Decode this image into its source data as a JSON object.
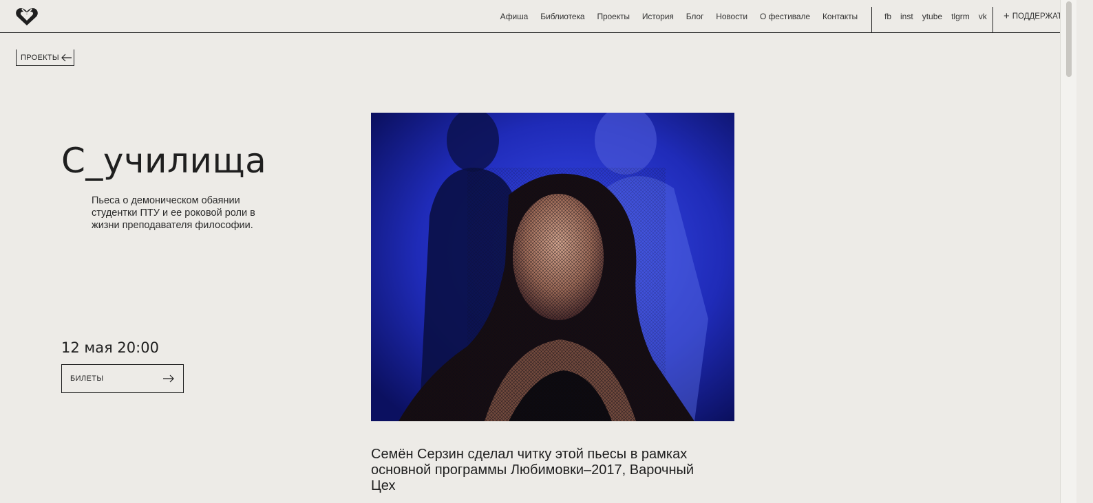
{
  "header": {
    "nav": [
      "Афиша",
      "Библиотека",
      "Проекты",
      "История",
      "Блог",
      "Новости",
      "О фестивале",
      "Контакты"
    ],
    "social": [
      "fb",
      "inst",
      "ytube",
      "tlgrm",
      "vk"
    ],
    "support_label": "ПОДДЕРЖАТЬ"
  },
  "back": {
    "label": "ПРОЕКТЫ"
  },
  "hero": {
    "title": "С_училища",
    "description": "Пьеса о демоническом обаянии студентки ПТУ и ее роковой роли в жизни преподавателя философии.",
    "date": "12 мая 20:00",
    "tickets_label": "БИЛЕТЫ"
  },
  "caption": "Семён Серзин сделал читку этой пьесы в рамках основной программы Любимовки–2017, Варочный Цех",
  "colors": {
    "background": "#edebe7",
    "ink": "#1f1f1f",
    "photo_blue": "#2b3ad0"
  },
  "icons": {
    "logo": "heart-logo-icon",
    "back": "arrow-left-icon",
    "tickets": "arrow-right-icon",
    "support": "plus-icon"
  }
}
